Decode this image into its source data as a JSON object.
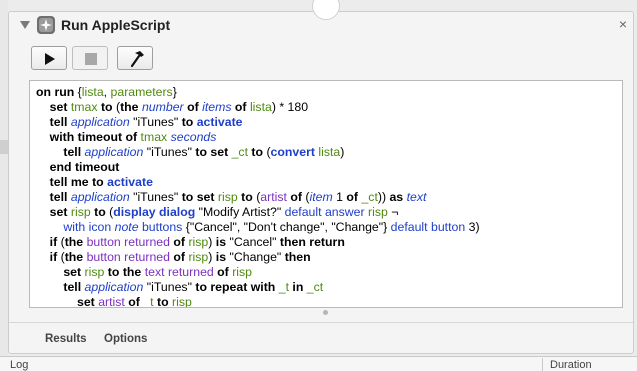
{
  "window": {
    "title": "Run AppleScript",
    "close_glyph": "×",
    "icons": {
      "collapse": "disclosure-triangle-icon",
      "app": "applescript-icon",
      "close": "close-icon",
      "run": "play-icon",
      "stop": "stop-icon",
      "compile": "hammer-icon"
    }
  },
  "code": {
    "lines": [
      "on run {lista, parameters}",
      "set tmax to (the number of items of lista) * 180",
      "tell application \"iTunes\" to activate",
      "with timeout of tmax seconds",
      "tell application \"iTunes\" to set _ct to (convert lista)",
      "end timeout",
      "tell me to activate",
      "tell application \"iTunes\" to set risp to (artist of (item 1 of _ct)) as text",
      "set risp to (display dialog \"Modify Artist?\" default answer risp ¬",
      "with icon note buttons {\"Cancel\", \"Don't change\", \"Change\"} default button 3)",
      "if (the button returned of risp) is \"Cancel\" then return",
      "if (the button returned of risp) is \"Change\" then",
      "set risp to the text returned of risp",
      "tell application \"iTunes\" to repeat with _t in _ct",
      "set artist of _t to risp"
    ]
  },
  "tabs": {
    "results": "Results",
    "options": "Options"
  },
  "bottom": {
    "log": "Log",
    "duration": "Duration"
  },
  "colors": {
    "keyword": "#000000",
    "keyword_blue": "#1e3fc8",
    "variable": "#4f8a10",
    "property": "#7b2fbf"
  }
}
